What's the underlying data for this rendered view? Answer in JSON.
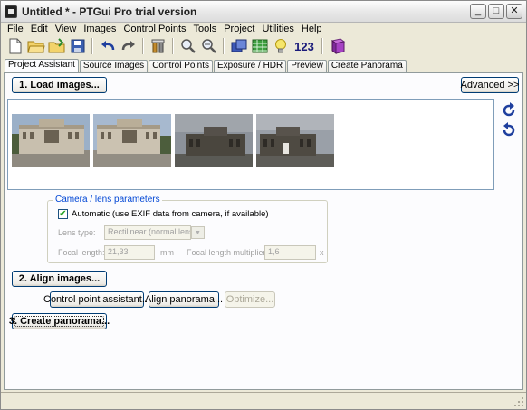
{
  "window": {
    "title": "Untitled * - PTGui Pro trial version"
  },
  "title_buttons": {
    "minimize": "_",
    "maximize": "□",
    "close": "✕"
  },
  "menu": [
    "File",
    "Edit",
    "View",
    "Images",
    "Control Points",
    "Tools",
    "Project",
    "Utilities",
    "Help"
  ],
  "toolbar": {
    "icons": [
      "new-file-icon",
      "open-folder-icon",
      "open-folder-arrow-icon",
      "save-icon",
      "undo-icon",
      "redo-icon",
      "wrench-tools-icon",
      "zoom-in-icon",
      "zoom-out-icon",
      "panorama-editor-icon",
      "table-icon",
      "lightbulb-icon",
      "numbers-icon",
      "book-icon"
    ],
    "numbers_label": "123"
  },
  "tabs": [
    "Project Assistant",
    "Source Images",
    "Control Points",
    "Exposure / HDR",
    "Preview",
    "Create Panorama"
  ],
  "active_tab": "Project Assistant",
  "assistant": {
    "load_images": "1. Load images...",
    "advanced": "Advanced >>",
    "align_images": "2. Align images...",
    "control_point_assistant": "Control point assistant...",
    "align_panorama": "Align panorama...",
    "optimize": "Optimize...",
    "create_panorama": "3. Create panorama..."
  },
  "camera": {
    "group_title": "Camera / lens parameters",
    "automatic_label": "Automatic (use EXIF data from camera, if available)",
    "automatic_checked": true,
    "lens_type_label": "Lens type:",
    "lens_type_value": "Rectilinear (normal lens)",
    "focal_length_label": "Focal length:",
    "focal_length_value": "21,33",
    "focal_length_unit": "mm",
    "multiplier_label": "Focal length multiplier:",
    "multiplier_value": "1,6",
    "multiplier_unit": "x"
  },
  "colors": {
    "group_title": "#0046d5",
    "button_border": "#003c74",
    "check": "#21a121"
  }
}
